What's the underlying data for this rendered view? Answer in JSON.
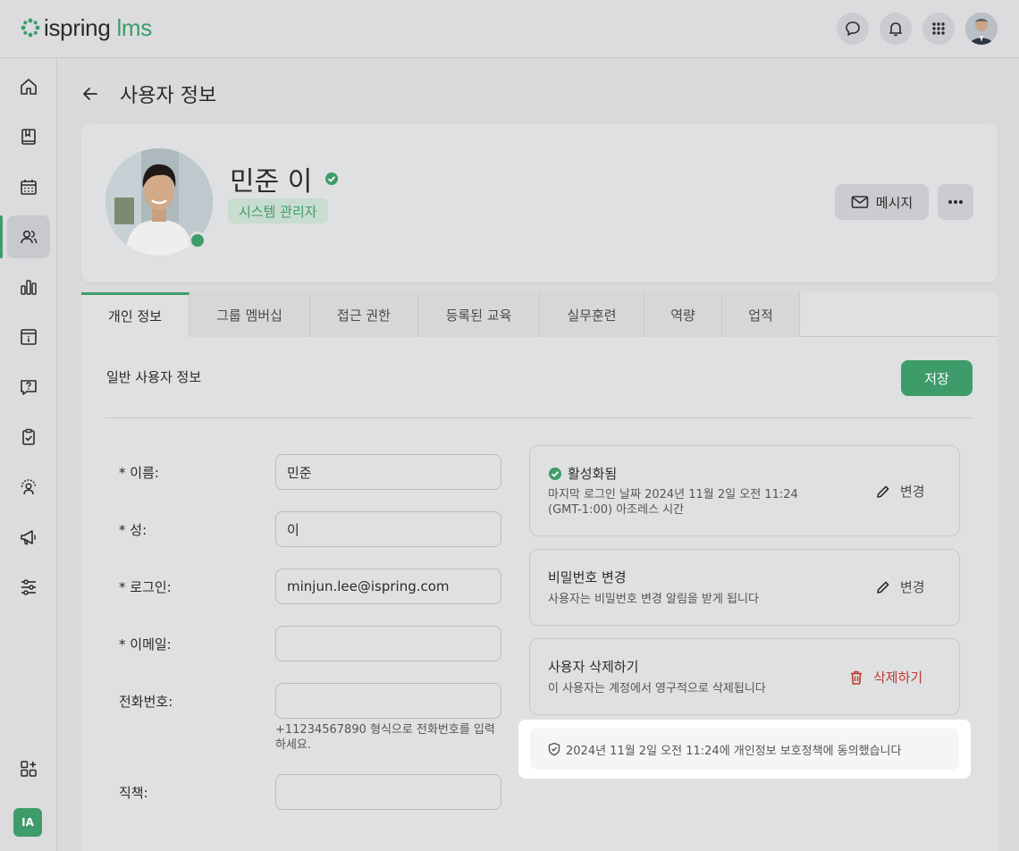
{
  "app": {
    "logo_main": "ispring",
    "logo_accent": "lms"
  },
  "header": {
    "icons": [
      "chat-icon",
      "bell-icon",
      "apps-grid-icon"
    ]
  },
  "sidebar": {
    "items": [
      "home-icon",
      "book-icon",
      "calendar-icon",
      "users-icon",
      "chart-icon",
      "info-panel-icon",
      "help-icon",
      "clipboard-check-icon",
      "trainer-icon",
      "megaphone-icon",
      "settings-sliders-icon"
    ],
    "bottom_icon": "add-widget-icon",
    "user_initials": "IA"
  },
  "page": {
    "title": "사용자 정보"
  },
  "profile": {
    "name": "민준 이",
    "role": "시스템 관리자",
    "message_label": "메시지",
    "colors": {
      "accent": "#3e9c6a"
    }
  },
  "tabs": [
    "개인 정보",
    "그룹 멤버십",
    "접근 권한",
    "등록된 교육",
    "실무훈련",
    "역량",
    "업적"
  ],
  "general": {
    "section_title": "일반 사용자 정보",
    "save_label": "저장",
    "fields": [
      {
        "label": "* 이름:",
        "value": "민준"
      },
      {
        "label": "* 성:",
        "value": "이"
      },
      {
        "label": "* 로그인:",
        "value": "minjun.lee@ispring.com"
      },
      {
        "label": "* 이메일:",
        "value": ""
      },
      {
        "label": "전화번호:",
        "value": ""
      },
      {
        "label": "직책:",
        "value": ""
      }
    ],
    "phone_hint": "+11234567890 형식으로 전화번호를 입력하세요."
  },
  "status": {
    "active_title": "활성화됨",
    "active_desc": "마지막 로그인 날짜 2024년 11월 2일 오전 11:24 (GMT-1:00) 아조레스 시간",
    "change_label": "변경",
    "password_title": "비밀번호 변경",
    "password_desc": "사용자는 비밀번호 변경 알림을 받게 됩니다",
    "delete_title": "사용자 삭제하기",
    "delete_desc": "이 사용자는 계정에서 영구적으로 삭제됩니다",
    "delete_label": "삭제하기",
    "consent_text": "2024년 11월 2일 오전 11:24에 개인정보 보호정책에 동의했습니다"
  }
}
